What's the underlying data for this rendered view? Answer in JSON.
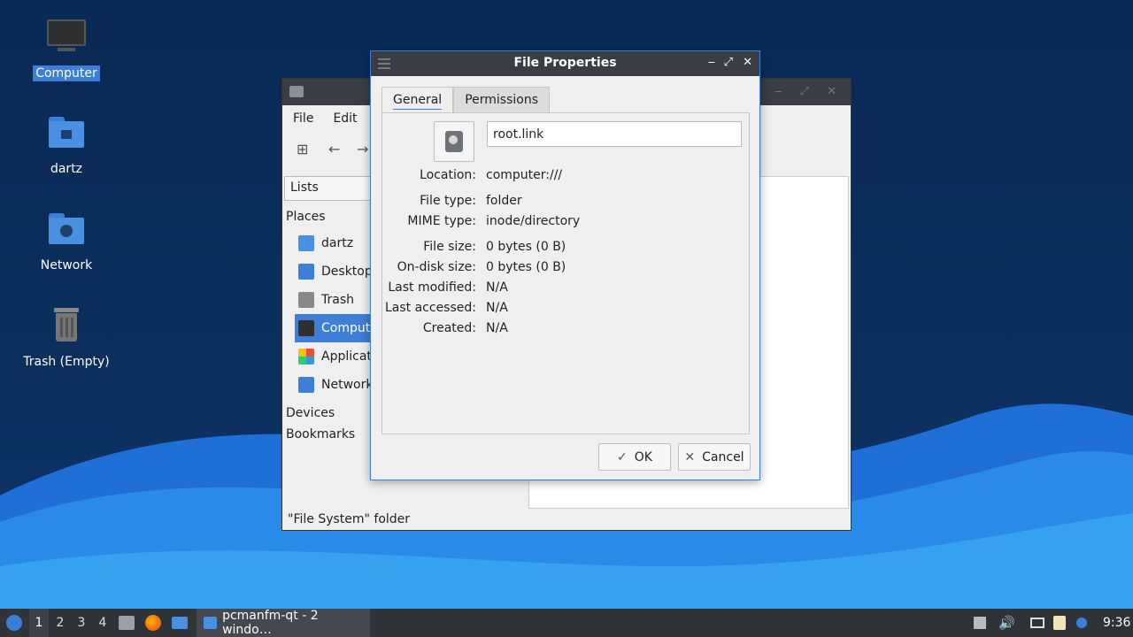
{
  "desktop": {
    "icons": [
      {
        "label": "Computer",
        "icon": "computer-icon"
      },
      {
        "label": "dartz",
        "icon": "home-folder-icon"
      },
      {
        "label": "Network",
        "icon": "network-folder-icon"
      },
      {
        "label": "Trash (Empty)",
        "icon": "trash-icon"
      }
    ]
  },
  "file_manager": {
    "menu": [
      "File",
      "Edit"
    ],
    "side_pane_mode": "Lists",
    "places_header": "Places",
    "places": [
      {
        "label": "dartz",
        "icon": "home-folder-icon"
      },
      {
        "label": "Desktop",
        "icon": "desktop-icon"
      },
      {
        "label": "Trash",
        "icon": "trash-icon"
      },
      {
        "label": "Computer",
        "icon": "computer-icon"
      },
      {
        "label": "Applications",
        "icon": "applications-icon"
      },
      {
        "label": "Network",
        "icon": "network-icon"
      }
    ],
    "devices_header": "Devices",
    "bookmarks_header": "Bookmarks",
    "status": "\"File System\" folder"
  },
  "dialog": {
    "title": "File Properties",
    "tabs": [
      "General",
      "Permissions"
    ],
    "file_name": "root.link",
    "properties": [
      {
        "key": "Location:",
        "value": "computer:///"
      },
      {
        "key": "File type:",
        "value": "folder"
      },
      {
        "key": "MIME type:",
        "value": "inode/directory"
      },
      {
        "key": "File size:",
        "value": "0 bytes (0 B)"
      },
      {
        "key": "On-disk size:",
        "value": "0 bytes (0 B)"
      },
      {
        "key": "Last modified:",
        "value": "N/A"
      },
      {
        "key": "Last accessed:",
        "value": "N/A"
      },
      {
        "key": "Created:",
        "value": "N/A"
      }
    ],
    "ok_label": "OK",
    "cancel_label": "Cancel"
  },
  "taskbar": {
    "workspaces": [
      "1",
      "2",
      "3",
      "4"
    ],
    "active_workspace": "1",
    "task_label": "pcmanfm-qt - 2 windo…",
    "clock": "9:36"
  },
  "colors": {
    "accent": "#3d7fd6",
    "titlebar": "#3a3d44",
    "taskbar": "#2f3237"
  }
}
